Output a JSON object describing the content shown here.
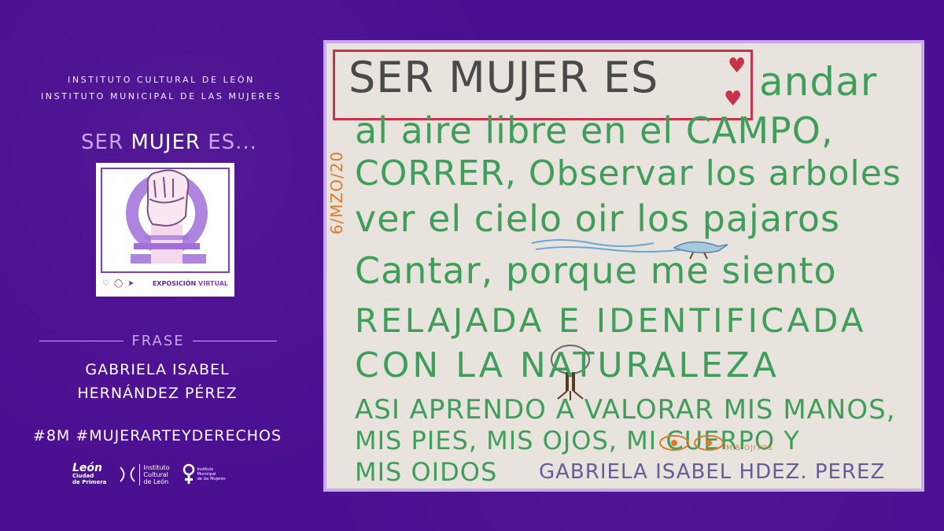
{
  "institutions": {
    "line1": "INSTITUTO CULTURAL DE LEÓN",
    "line2": "INSTITUTO MUNICIPAL DE LAS MUJERES"
  },
  "logo": {
    "title_ser": "SER",
    "title_mujer": "MUJER",
    "title_es": "ES...",
    "badge_label_prefix": "EXPOSICIÓN",
    "badge_label_highlight": "VIRTUAL",
    "icons": [
      "heart-icon",
      "comment-icon",
      "send-icon"
    ]
  },
  "section": {
    "label": "FRASE",
    "author_line1": "GABRIELA ISABEL",
    "author_line2": "HERNÁNDEZ PÉREZ",
    "hashtags": "#8M  #MUJERARTEYDERECHOS"
  },
  "footer_logos": {
    "leon_main": "León",
    "leon_sub1": "Ciudad",
    "leon_sub2": "de Primera",
    "icl_line1": "Instituto",
    "icl_line2": "Cultural",
    "icl_line3": "de León",
    "imm_line1": "Instituto",
    "imm_line2": "Municipal",
    "imm_line3": "de las Mujeres"
  },
  "artwork": {
    "date": "6/MZO/20",
    "title": "SER MUJER ES",
    "lines": [
      "andar",
      "al aire libre en el CAMPO,",
      "CORRER, Observar los arboles",
      "ver el cielo oir los pajaros",
      "Cantar, porque me siento",
      "RELAJADA E IDENTIFICADA",
      "CON LA    NATURALEZA",
      "ASI APRENDO A VALORAR MIS MANOS,",
      "MIS PIES, MIS OJOS, MI CUERPO Y",
      "MIS OIDOS"
    ],
    "eyes_label": "MIS OJITOS",
    "signature": "GABRIELA ISABEL HDEZ. PEREZ",
    "colors": {
      "green": "#3f9e5a",
      "red": "#c8324a",
      "orange": "#e07a2a",
      "purple": "#6a5a9a"
    }
  },
  "colors": {
    "background": "#4b0f91",
    "accent_light": "#c9a7ef",
    "frame": "#c8a8f0"
  }
}
